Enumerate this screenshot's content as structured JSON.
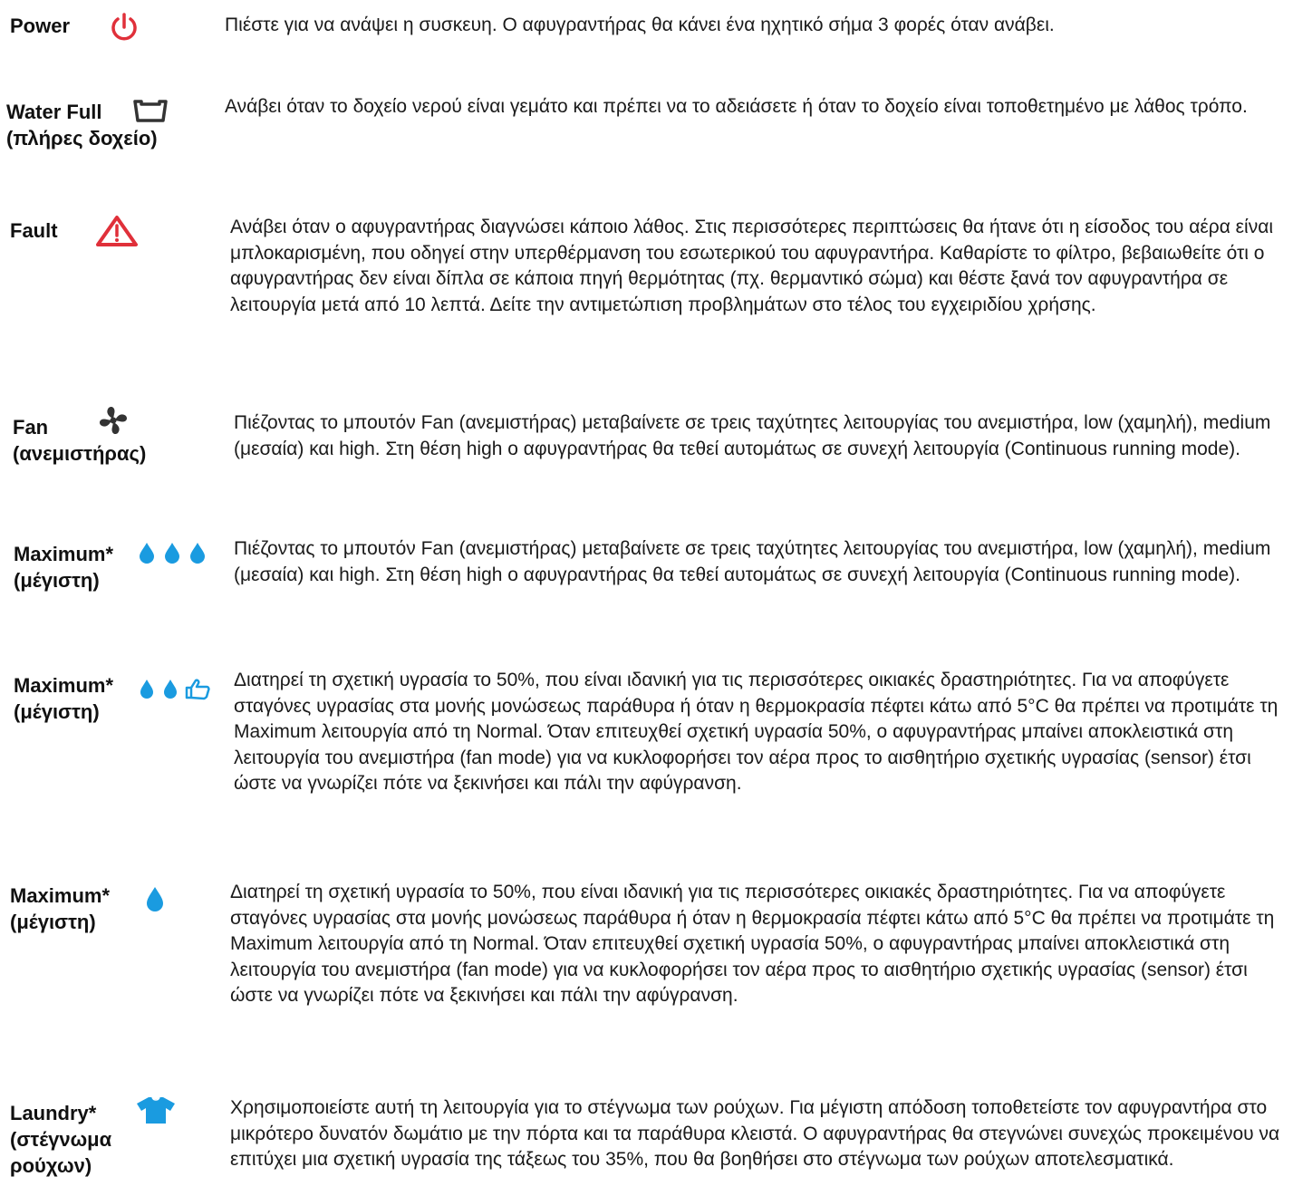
{
  "colors": {
    "red_icon": "#e0303a",
    "blue_icon": "#1a9be0",
    "dark_icon": "#333333"
  },
  "items": [
    {
      "label_lines": [
        "Power"
      ],
      "icon": "power-icon",
      "description": "Πιέστε για να ανάψει η συσκευη. Ο αφυγραντήρας θα κάνει ένα ηχητικό σήμα 3 φορές όταν ανάβει."
    },
    {
      "label_lines": [
        "Water Full",
        "(πλήρες δοχείο)"
      ],
      "icon": "water-tank-icon",
      "description": "Ανάβει όταν το δοχείο νερού είναι γεμάτο και πρέπει να το αδειάσετε ή όταν το δοχείο είναι τοποθετημένο με λάθος τρόπο."
    },
    {
      "label_lines": [
        "Fault"
      ],
      "icon": "warning-triangle-icon",
      "description": "Ανάβει όταν ο αφυγραντήρας διαγνώσει κάποιο λάθος. Στις περισσότερες περιπτώσεις θα ήτανε ότι η είσοδος του αέρα είναι μπλοκαρισμένη, που οδηγεί στην υπερθέρμανση του εσωτερικού του αφυγραντήρα. Καθαρίστε το φίλτρο, βεβαιωθείτε ότι ο αφυγραντήρας δεν είναι δίπλα σε κάποια πηγή θερμότητας (πχ. θερμαντικό σώμα) και θέστε ξανά τον αφυγραντήρα σε λειτουργία μετά από 10 λεπτά. Δείτε την αντιμετώπιση προβλημάτων στο τέλος του εγχειριδίου χρήσης."
    },
    {
      "label_lines": [
        "Fan",
        "(ανεμιστήρας)"
      ],
      "icon": "fan-icon",
      "description": "Πιέζοντας το μπουτόν Fan (ανεμιστήρας) μεταβαίνετε σε τρεις ταχύτητες λειτουργίας του ανεμιστήρα, low (χαμηλή), medium (μεσαία) και high. Στη θέση high ο αφυγραντήρας θα τεθεί αυτομάτως σε συνεχή λειτουργία (Continuous running mode)."
    },
    {
      "label_lines": [
        "Maximum*",
        "(μέγιστη)"
      ],
      "icon": "three-drops-icon",
      "description": "Πιέζοντας το μπουτόν Fan (ανεμιστήρας) μεταβαίνετε σε τρεις ταχύτητες λειτουργίας του ανεμιστήρα, low (χαμηλή), medium (μεσαία) και high. Στη θέση high ο αφυγραντήρας θα τεθεί αυτομάτως σε συνεχή λειτουργία (Continuous running mode)."
    },
    {
      "label_lines": [
        "Maximum*",
        "(μέγιστη)"
      ],
      "icon": "two-drops-thumbs-up-icon",
      "description": "Διατηρεί τη σχετική υγρασία το 50%, που είναι ιδανική για τις περισσότερες οικιακές δραστηριότητες. Για να αποφύγετε σταγόνες υγρασίας στα μονής μονώσεως παράθυρα ή όταν η θερμοκρασία πέφτει κάτω από 5°C θα πρέπει να προτιμάτε τη Maximum λειτουργία από τη Normal. Όταν επιτευχθεί σχετική υγρασία 50%, ο αφυγραντήρας μπαίνει αποκλειστικά στη λειτουργία του ανεμιστήρα (fan mode) για να κυκλοφορήσει τον αέρα προς το αισθητήριο σχετικής υγρασίας (sensor) έτσι ώστε να γνωρίζει πότε να ξεκινήσει και πάλι την αφύγρανση."
    },
    {
      "label_lines": [
        "Maximum*",
        "(μέγιστη)"
      ],
      "icon": "single-drop-icon",
      "description": "Διατηρεί τη σχετική υγρασία το 50%, που είναι ιδανική για τις περισσότερες οικιακές δραστηριότητες. Για να αποφύγετε σταγόνες υγρασίας στα μονής μονώσεως παράθυρα ή όταν η θερμοκρασία πέφτει κάτω από 5°C θα πρέπει να προτιμάτε τη Maximum λειτουργία από τη Normal. Όταν επιτευχθεί σχετική υγρασία 50%, ο αφυγραντήρας μπαίνει αποκλειστικά στη λειτουργία του ανεμιστήρα (fan mode) για να κυκλοφορήσει τον αέρα προς το αισθητήριο σχετικής υγρασίας (sensor) έτσι ώστε να γνωρίζει πότε να ξεκινήσει και πάλι την αφύγρανση."
    },
    {
      "label_lines": [
        "Laundry*",
        "(στέγνωμα",
        "ρούχων)"
      ],
      "icon": "shirt-icon",
      "description": "Χρησιμοποιείστε αυτή τη λειτουργία για το στέγνωμα των ρούχων. Για μέγιστη απόδοση τοποθετείστε τον αφυγραντήρα στο μικρότερο δυνατόν δωμάτιο με την πόρτα και τα παράθυρα κλειστά. Ο αφυγραντήρας θα στεγνώνει συνεχώς προκειμένου να επιτύχει μια σχετική υγρασία της τάξεως του 35%, που θα βοηθήσει στο στέγνωμα των ρούχων αποτελεσματικά."
    }
  ]
}
